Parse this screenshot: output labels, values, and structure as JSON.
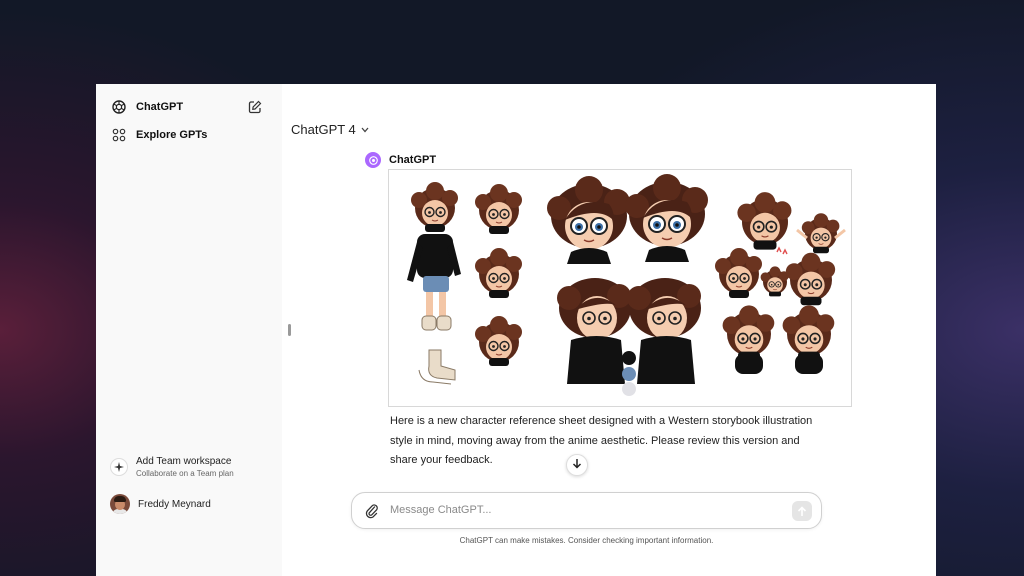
{
  "sidebar": {
    "app_title": "ChatGPT",
    "explore_label": "Explore GPTs",
    "team": {
      "title": "Add Team workspace",
      "subtitle": "Collaborate on a Team plan"
    },
    "user": {
      "name": "Freddy Meynard"
    }
  },
  "header": {
    "model_label": "ChatGPT 4"
  },
  "message": {
    "author": "ChatGPT",
    "text": "Here is a new character reference sheet designed with a Western storybook illustration style in mind, moving away from the anime aesthetic. Please review this version and share your feedback."
  },
  "composer": {
    "placeholder": "Message ChatGPT..."
  },
  "footer": {
    "disclaimer": "ChatGPT can make mistakes. Consider checking important information."
  },
  "icons": [
    "openai-logo-icon",
    "new-chat-icon",
    "explore-grid-icon",
    "sparkle-icon",
    "arrow-down-icon",
    "paperclip-icon",
    "arrow-up-icon",
    "chevron-down-icon"
  ],
  "colors": {
    "accent_gpt": "#ab68ff",
    "sidebar_bg": "#f9f9f9",
    "hair": "#5a2a1a",
    "skin": "#f3c6a6",
    "sweater": "#111111"
  }
}
